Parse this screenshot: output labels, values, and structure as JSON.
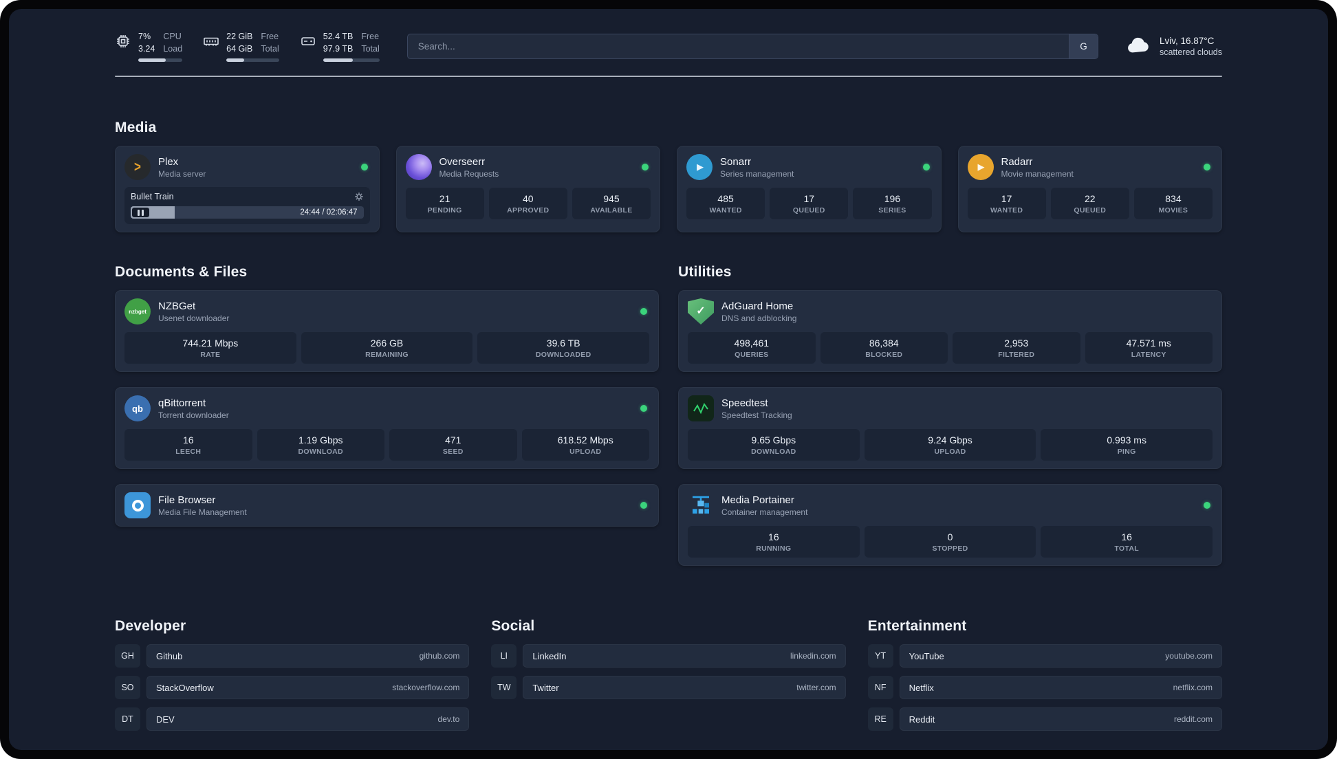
{
  "colors": {
    "background": "#171e2e",
    "card": "#232d40",
    "tile": "#1b2435",
    "status_online": "#3bd47c",
    "divider": "#c2c9d4",
    "plex": "#e8a22b",
    "overseerr": "#6a50d8",
    "sonarr": "#2f9ad1",
    "radarr": "#e8a52d",
    "nzbget": "#41a046",
    "qbittorrent": "#3a6fb0",
    "filebrowser": "#3d96d9",
    "adguard": "#4fae68",
    "speedtest": "#31d36d",
    "portainer": "#2da2e8"
  },
  "header": {
    "resources": [
      {
        "name": "cpu",
        "values": [
          "7%",
          "3.24"
        ],
        "labels": [
          "CPU",
          "Load"
        ],
        "progress": 62
      },
      {
        "name": "memory",
        "values": [
          "22 GiB",
          "64 GiB"
        ],
        "labels": [
          "Free",
          "Total"
        ],
        "progress": 34
      },
      {
        "name": "disk",
        "values": [
          "52.4 TB",
          "97.9 TB"
        ],
        "labels": [
          "Free",
          "Total"
        ],
        "progress": 53
      }
    ],
    "search": {
      "placeholder": "Search...",
      "button_label": "G"
    },
    "weather": {
      "location": "Lviv, 16.87°C",
      "condition": "scattered clouds"
    }
  },
  "sections": {
    "media": {
      "title": "Media",
      "cards": [
        {
          "name": "Plex",
          "subtitle": "Media server",
          "icon_glyph": ">",
          "online": true,
          "player": {
            "title": "Bullet Train",
            "time": "24:44 / 02:06:47",
            "progress": 19
          }
        },
        {
          "name": "Overseerr",
          "subtitle": "Media Requests",
          "online": true,
          "stats": [
            {
              "value": "21",
              "label": "PENDING"
            },
            {
              "value": "40",
              "label": "APPROVED"
            },
            {
              "value": "945",
              "label": "AVAILABLE"
            }
          ]
        },
        {
          "name": "Sonarr",
          "subtitle": "Series management",
          "icon_glyph": "▶",
          "online": true,
          "stats": [
            {
              "value": "485",
              "label": "WANTED"
            },
            {
              "value": "17",
              "label": "QUEUED"
            },
            {
              "value": "196",
              "label": "SERIES"
            }
          ]
        },
        {
          "name": "Radarr",
          "subtitle": "Movie management",
          "icon_glyph": "▶",
          "online": true,
          "stats": [
            {
              "value": "17",
              "label": "WANTED"
            },
            {
              "value": "22",
              "label": "QUEUED"
            },
            {
              "value": "834",
              "label": "MOVIES"
            }
          ]
        }
      ]
    },
    "documents": {
      "title": "Documents & Files",
      "cards": [
        {
          "name": "NZBGet",
          "subtitle": "Usenet downloader",
          "icon_glyph": "nzbget",
          "online": true,
          "stats": [
            {
              "value": "744.21 Mbps",
              "label": "RATE"
            },
            {
              "value": "266 GB",
              "label": "REMAINING"
            },
            {
              "value": "39.6 TB",
              "label": "DOWNLOADED"
            }
          ]
        },
        {
          "name": "qBittorrent",
          "subtitle": "Torrent downloader",
          "icon_glyph": "qb",
          "online": true,
          "stats": [
            {
              "value": "16",
              "label": "LEECH"
            },
            {
              "value": "1.19 Gbps",
              "label": "DOWNLOAD"
            },
            {
              "value": "471",
              "label": "SEED"
            },
            {
              "value": "618.52 Mbps",
              "label": "UPLOAD"
            }
          ]
        },
        {
          "name": "File Browser",
          "subtitle": "Media File Management",
          "online": true
        }
      ]
    },
    "utilities": {
      "title": "Utilities",
      "cards": [
        {
          "name": "AdGuard Home",
          "subtitle": "DNS and adblocking",
          "icon_glyph": "✓",
          "stats": [
            {
              "value": "498,461",
              "label": "QUERIES"
            },
            {
              "value": "86,384",
              "label": "BLOCKED"
            },
            {
              "value": "2,953",
              "label": "FILTERED"
            },
            {
              "value": "47.571 ms",
              "label": "LATENCY"
            }
          ]
        },
        {
          "name": "Speedtest",
          "subtitle": "Speedtest Tracking",
          "stats": [
            {
              "value": "9.65 Gbps",
              "label": "DOWNLOAD"
            },
            {
              "value": "9.24 Gbps",
              "label": "UPLOAD"
            },
            {
              "value": "0.993 ms",
              "label": "PING"
            }
          ]
        },
        {
          "name": "Media Portainer",
          "subtitle": "Container management",
          "online": true,
          "stats": [
            {
              "value": "16",
              "label": "RUNNING"
            },
            {
              "value": "0",
              "label": "STOPPED"
            },
            {
              "value": "16",
              "label": "TOTAL"
            }
          ]
        }
      ]
    }
  },
  "bookmarks": [
    {
      "title": "Developer",
      "items": [
        {
          "abbr": "GH",
          "name": "Github",
          "url": "github.com"
        },
        {
          "abbr": "SO",
          "name": "StackOverflow",
          "url": "stackoverflow.com"
        },
        {
          "abbr": "DT",
          "name": "DEV",
          "url": "dev.to"
        }
      ]
    },
    {
      "title": "Social",
      "items": [
        {
          "abbr": "LI",
          "name": "LinkedIn",
          "url": "linkedin.com"
        },
        {
          "abbr": "TW",
          "name": "Twitter",
          "url": "twitter.com"
        }
      ]
    },
    {
      "title": "Entertainment",
      "items": [
        {
          "abbr": "YT",
          "name": "YouTube",
          "url": "youtube.com"
        },
        {
          "abbr": "NF",
          "name": "Netflix",
          "url": "netflix.com"
        },
        {
          "abbr": "RE",
          "name": "Reddit",
          "url": "reddit.com"
        }
      ]
    }
  ]
}
